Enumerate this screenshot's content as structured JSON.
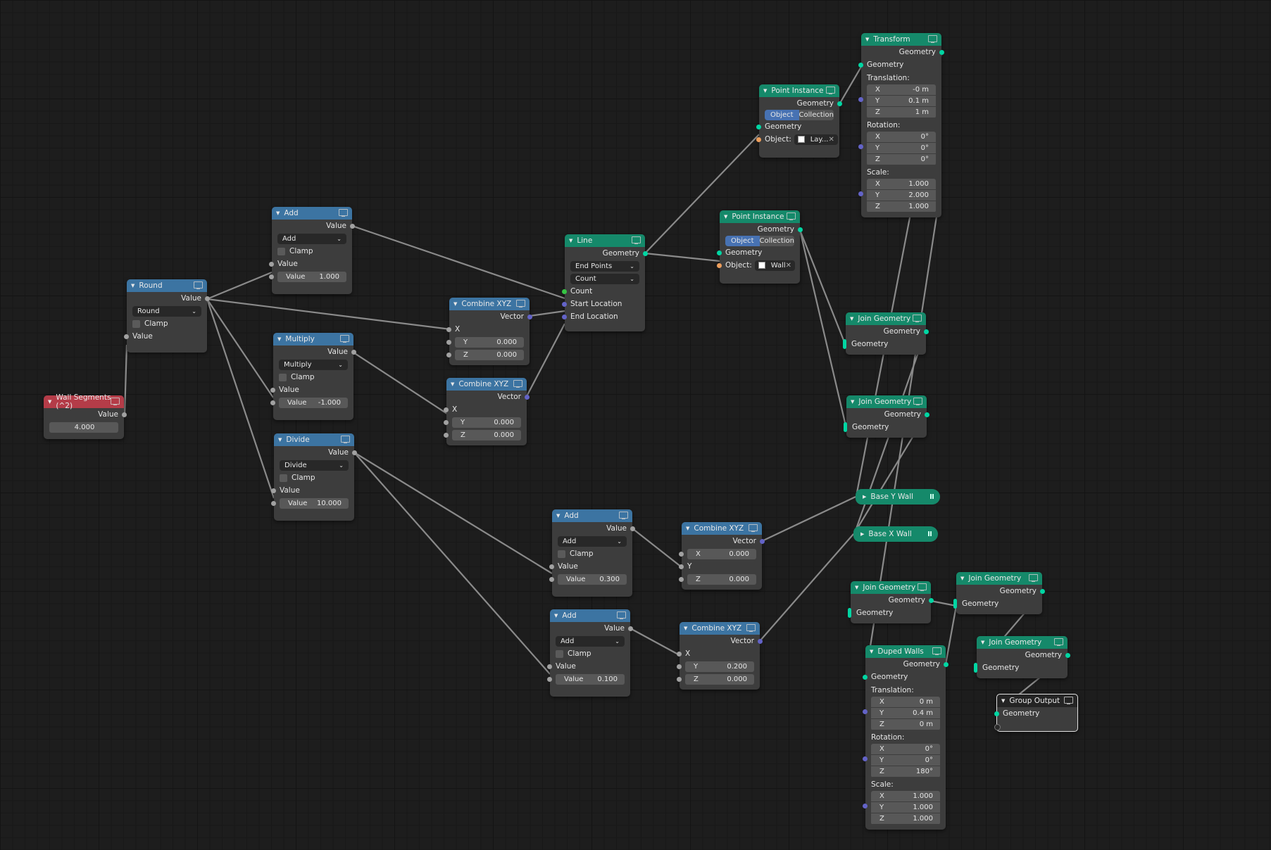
{
  "app": "Blender Geometry Nodes Editor",
  "colors": {
    "math_header": "#3c74a2",
    "geometry_header": "#15896a",
    "input_header": "#b43c48",
    "geometry_socket": "#00d6a3",
    "vector_socket": "#6363c7",
    "value_socket": "#a1a1a1",
    "integer_socket": "#36c444",
    "object_socket": "#ed9e5c"
  },
  "nodes": {
    "wall_segments": {
      "title": "Wall Segments (^2)",
      "out": "Value",
      "value": "4.000"
    },
    "round": {
      "title": "Round",
      "out": "Value",
      "op": "Round",
      "clamp": "Clamp",
      "in": "Value"
    },
    "add1": {
      "title": "Add",
      "out": "Value",
      "op": "Add",
      "clamp": "Clamp",
      "in": "Value",
      "field_label": "Value",
      "field_value": "1.000"
    },
    "multiply": {
      "title": "Multiply",
      "out": "Value",
      "op": "Multiply",
      "clamp": "Clamp",
      "in": "Value",
      "field_label": "Value",
      "field_value": "-1.000"
    },
    "divide": {
      "title": "Divide",
      "out": "Value",
      "op": "Divide",
      "clamp": "Clamp",
      "in": "Value",
      "field_label": "Value",
      "field_value": "10.000"
    },
    "combine1": {
      "title": "Combine XYZ",
      "out": "Vector",
      "x": "X",
      "y_label": "Y",
      "y": "0.000",
      "z_label": "Z",
      "z": "0.000"
    },
    "combine2": {
      "title": "Combine XYZ",
      "out": "Vector",
      "x": "X",
      "y_label": "Y",
      "y": "0.000",
      "z_label": "Z",
      "z": "0.000"
    },
    "line": {
      "title": "Line",
      "out": "Geometry",
      "mode": "End Points",
      "count_mode": "Count",
      "in_count": "Count",
      "in_start": "Start Location",
      "in_end": "End Location"
    },
    "point_instance1": {
      "title": "Point Instance",
      "out": "Geometry",
      "seg_on": "Object",
      "seg_off": "Collection",
      "in_geo": "Geometry",
      "obj_label": "Object:",
      "obj": "Lay..."
    },
    "point_instance2": {
      "title": "Point Instance",
      "out": "Geometry",
      "seg_on": "Object",
      "seg_off": "Collection",
      "in_geo": "Geometry",
      "obj_label": "Object:",
      "obj": "Wall"
    },
    "transform": {
      "title": "Transform",
      "out": "Geometry",
      "in_geo": "Geometry",
      "translation_label": "Translation:",
      "translation": [
        {
          "k": "X",
          "v": "-0 m"
        },
        {
          "k": "Y",
          "v": "0.1 m"
        },
        {
          "k": "Z",
          "v": "1 m"
        }
      ],
      "rotation_label": "Rotation:",
      "rotation": [
        {
          "k": "X",
          "v": "0°"
        },
        {
          "k": "Y",
          "v": "0°"
        },
        {
          "k": "Z",
          "v": "0°"
        }
      ],
      "scale_label": "Scale:",
      "scale": [
        {
          "k": "X",
          "v": "1.000"
        },
        {
          "k": "Y",
          "v": "2.000"
        },
        {
          "k": "Z",
          "v": "1.000"
        }
      ]
    },
    "join1": {
      "title": "Join Geometry",
      "out": "Geometry",
      "in": "Geometry"
    },
    "join2": {
      "title": "Join Geometry",
      "out": "Geometry",
      "in": "Geometry"
    },
    "base_y": {
      "title": "Base Y Wall"
    },
    "base_x": {
      "title": "Base X Wall"
    },
    "add2": {
      "title": "Add",
      "out": "Value",
      "op": "Add",
      "clamp": "Clamp",
      "in": "Value",
      "field_label": "Value",
      "field_value": "0.300"
    },
    "add3": {
      "title": "Add",
      "out": "Value",
      "op": "Add",
      "clamp": "Clamp",
      "in": "Value",
      "field_label": "Value",
      "field_value": "0.100"
    },
    "combine3": {
      "title": "Combine XYZ",
      "out": "Vector",
      "x_label": "X",
      "x": "0.000",
      "y": "Y",
      "z_label": "Z",
      "z": "0.000"
    },
    "combine4": {
      "title": "Combine XYZ",
      "out": "Vector",
      "x": "X",
      "y_label": "Y",
      "y": "0.200",
      "z_label": "Z",
      "z": "0.000"
    },
    "join3": {
      "title": "Join Geometry",
      "out": "Geometry",
      "in": "Geometry"
    },
    "join4": {
      "title": "Join Geometry",
      "out": "Geometry",
      "in": "Geometry"
    },
    "join5": {
      "title": "Join Geometry",
      "out": "Geometry",
      "in": "Geometry"
    },
    "duped_walls": {
      "title": "Duped Walls",
      "out": "Geometry",
      "in_geo": "Geometry",
      "translation_label": "Translation:",
      "translation": [
        {
          "k": "X",
          "v": "0 m"
        },
        {
          "k": "Y",
          "v": "0.4 m"
        },
        {
          "k": "Z",
          "v": "0 m"
        }
      ],
      "rotation_label": "Rotation:",
      "rotation": [
        {
          "k": "X",
          "v": "0°"
        },
        {
          "k": "Y",
          "v": "0°"
        },
        {
          "k": "Z",
          "v": "180°"
        }
      ],
      "scale_label": "Scale:",
      "scale": [
        {
          "k": "X",
          "v": "1.000"
        },
        {
          "k": "Y",
          "v": "1.000"
        },
        {
          "k": "Z",
          "v": "1.000"
        }
      ]
    },
    "group_output": {
      "title": "Group Output",
      "in": "Geometry"
    }
  }
}
